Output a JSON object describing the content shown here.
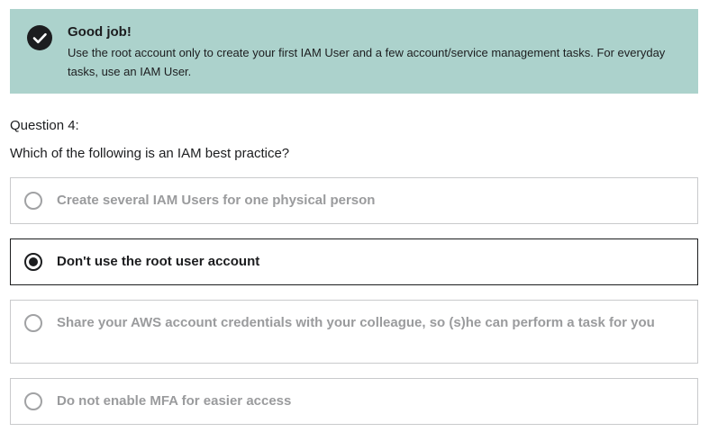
{
  "feedback": {
    "icon": "checkmark-icon",
    "title": "Good job!",
    "message": "Use the root account only to create your first IAM User and a few account/service management tasks. For everyday tasks, use an IAM User.",
    "background": "#acd2cc"
  },
  "question": {
    "number": "Question 4:",
    "text": "Which of the following is an IAM best practice?",
    "selected_index": 1,
    "options": [
      {
        "label": "Create several IAM Users for one physical person"
      },
      {
        "label": "Don't use the root user account"
      },
      {
        "label": "Share your AWS account credentials with your colleague, so (s)he can perform a task for you"
      },
      {
        "label": "Do not enable MFA for easier access"
      }
    ]
  }
}
